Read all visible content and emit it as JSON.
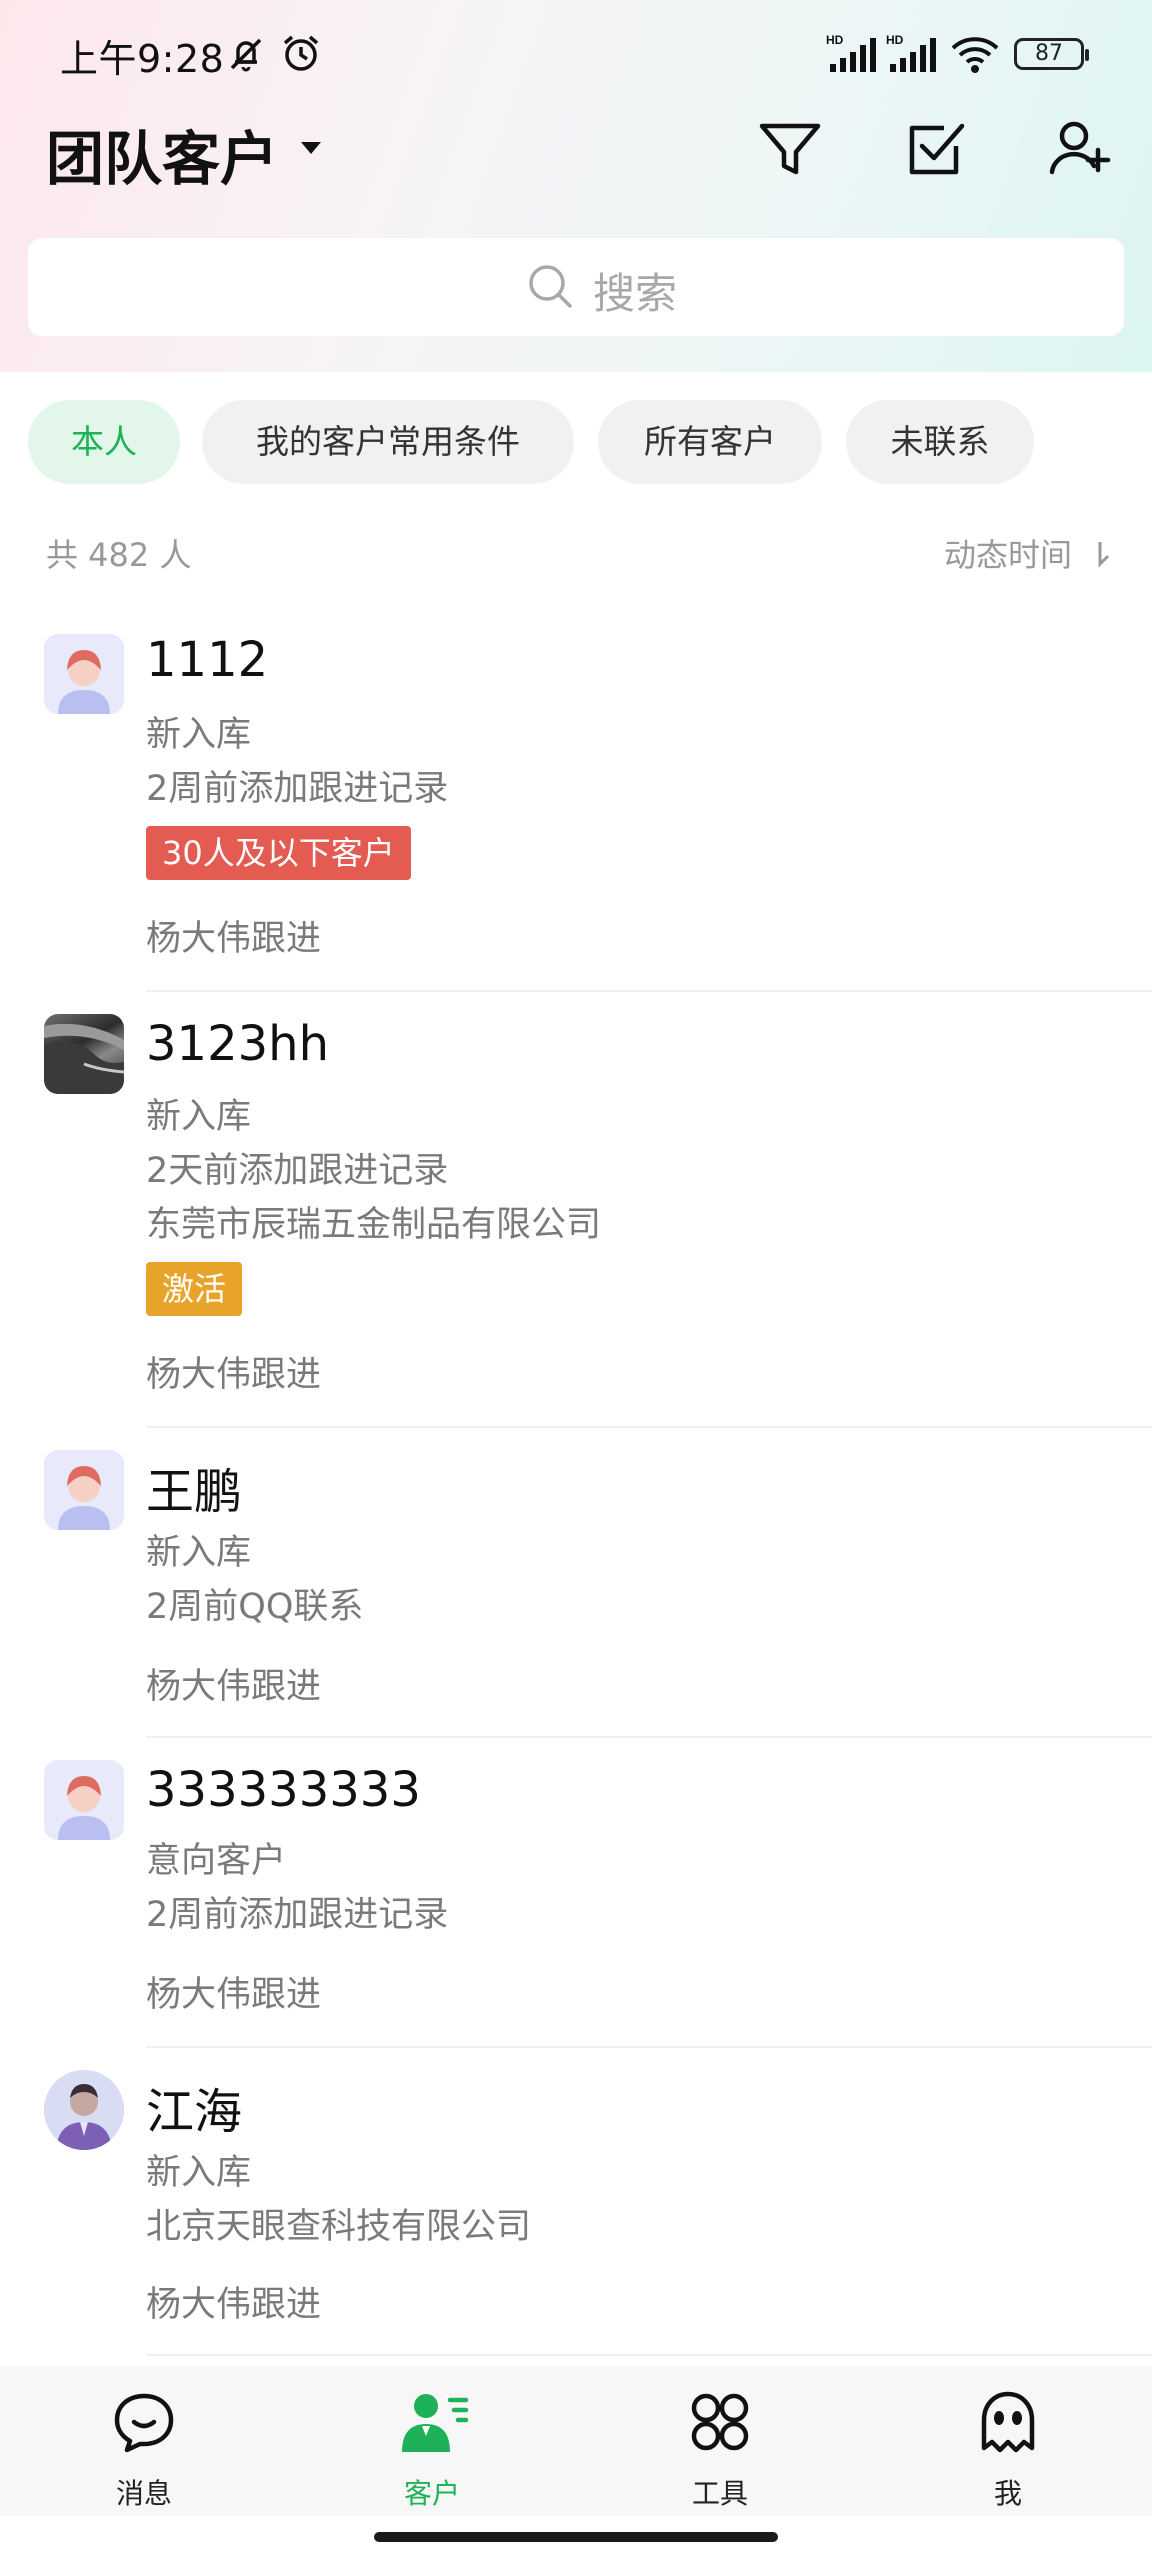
{
  "status_bar": {
    "time": "上午9:28",
    "battery": "87",
    "icons": [
      "mute-icon",
      "alarm-icon",
      "hd-signal-icon",
      "hd-signal-icon",
      "wifi-icon",
      "battery-icon"
    ]
  },
  "header": {
    "title": "团队客户",
    "actions": [
      "filter-icon",
      "checkbox-icon",
      "add-user-icon"
    ]
  },
  "search": {
    "placeholder": "搜索"
  },
  "chips": [
    {
      "label": "本人",
      "active": true
    },
    {
      "label": "我的客户常用条件",
      "active": false
    },
    {
      "label": "所有客户",
      "active": false
    },
    {
      "label": "未联系",
      "active": false
    }
  ],
  "summary": {
    "count_text": "共 482 人",
    "sort_label": "动态时间"
  },
  "customers": [
    {
      "name": "1112",
      "status": "新入库",
      "activity": "2周前添加跟进记录",
      "tag": "30人及以下客户",
      "follow": "杨大伟跟进"
    },
    {
      "name": "3123hh",
      "status": "新入库",
      "activity": "2天前添加跟进记录",
      "company": "东莞市辰瑞五金制品有限公司",
      "tag": "激活",
      "follow": "杨大伟跟进"
    },
    {
      "name": "王鹏",
      "status": "新入库",
      "activity": "2周前QQ联系",
      "follow": "杨大伟跟进"
    },
    {
      "name": "333333333",
      "status": "意向客户",
      "activity": "2周前添加跟进记录",
      "follow": "杨大伟跟进"
    },
    {
      "name": "江海",
      "status": "新入库",
      "company": "北京天眼查科技有限公司",
      "follow": "杨大伟跟进"
    }
  ],
  "bottom_nav": [
    {
      "label": "消息",
      "icon": "message-icon",
      "active": false
    },
    {
      "label": "客户",
      "icon": "customer-icon",
      "active": true
    },
    {
      "label": "工具",
      "icon": "tools-icon",
      "active": false
    },
    {
      "label": "我",
      "icon": "ghost-icon",
      "active": false
    }
  ],
  "colors": {
    "accent": "#1fb157",
    "tag_red": "#e45b52",
    "tag_orange": "#e8a42a"
  }
}
